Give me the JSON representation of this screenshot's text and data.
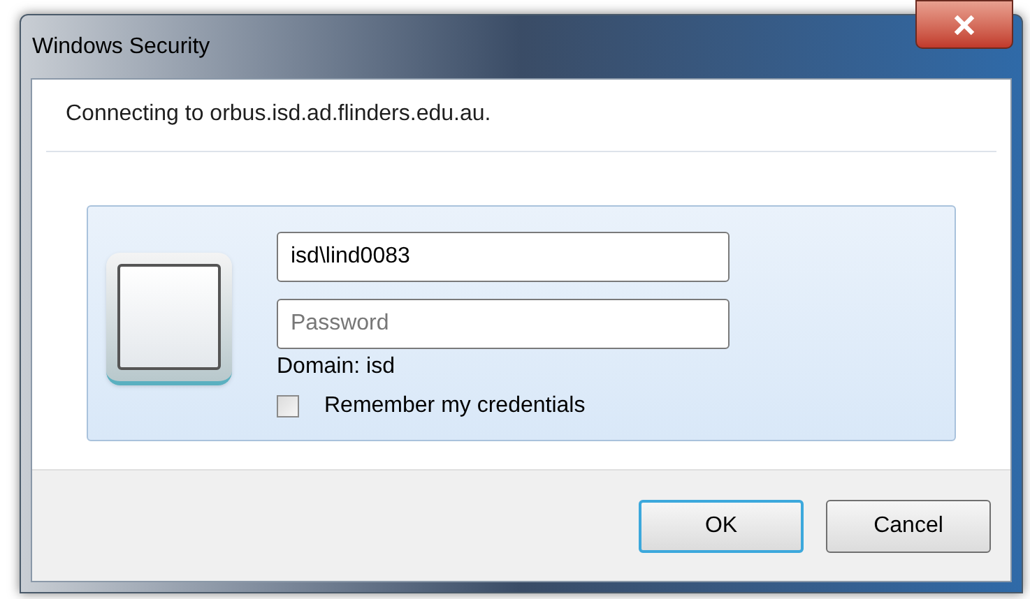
{
  "window": {
    "title": "Windows Security"
  },
  "message": "Connecting to orbus.isd.ad.flinders.edu.au.",
  "credentials": {
    "username": {
      "value": "isd\\lind0083"
    },
    "password": {
      "placeholder": "Password"
    },
    "domain": "Domain: isd",
    "remember": {
      "label": "Remember my credentials",
      "checked": false
    }
  },
  "buttons": [
    {
      "label": "OK",
      "default": true
    },
    {
      "label": "Cancel",
      "default": false
    }
  ]
}
